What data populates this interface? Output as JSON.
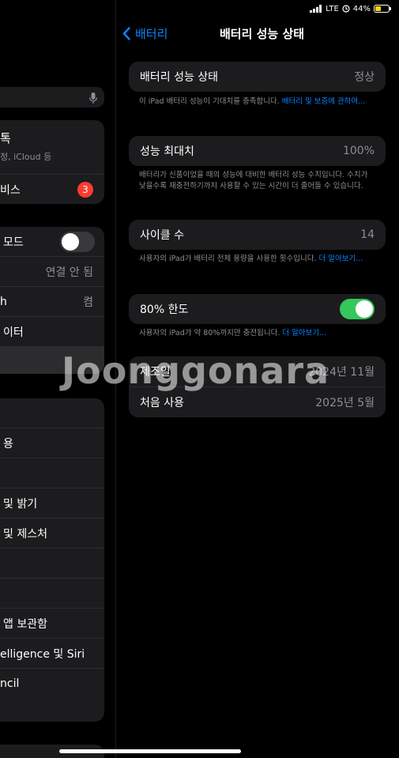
{
  "status_bar": {
    "carrier": "LTE",
    "battery_percent": "44%",
    "signal_bars": 4
  },
  "left_pane": {
    "profile": {
      "title": "톡",
      "subtitle": "정, iCloud 등"
    },
    "services_item": {
      "label": "비스",
      "badge": "3"
    },
    "airplane_mode": {
      "label": "모드",
      "on": false
    },
    "wifi": {
      "label": "",
      "value": "연결 안 됨"
    },
    "bluetooth": {
      "label": "h",
      "value": "켬"
    },
    "cellular": {
      "label": "이터"
    },
    "items": [
      {
        "label": ""
      },
      {
        "label": "용"
      },
      {
        "label": ""
      },
      {
        "label": "및 밝기"
      },
      {
        "label": "및 제스처"
      },
      {
        "label": ""
      },
      {
        "label": ""
      },
      {
        "label": "앱 보관함"
      },
      {
        "label": "elligence 및 Siri"
      },
      {
        "label": "ncil"
      }
    ]
  },
  "nav": {
    "back_label": "배터리",
    "title": "배터리 성능 상태"
  },
  "health": {
    "label": "배터리 성능 상태",
    "value": "정상",
    "note": "이 iPad 배터리 성능이 기대치를 충족합니다.",
    "note_link": "배터리 및 보증에 관하여..."
  },
  "max_capacity": {
    "label": "성능 최대치",
    "value": "100%",
    "note": "배터리가 신품이었을 때의 성능에 대비한 배터리 성능 수치입니다. 수치가 낮을수록 재충전하기까지 사용할 수 있는 시간이 더 줄어들 수 있습니다."
  },
  "cycle_count": {
    "label": "사이클 수",
    "value": "14",
    "note": "사용자의 iPad가 배터리 전체 용량을 사용한 횟수입니다.",
    "note_link": "더 알아보기..."
  },
  "limit_80": {
    "label": "80% 한도",
    "on": true,
    "note": "사용자의 iPad가 약 80%까지만 충전됩니다.",
    "note_link": "더 알아보기..."
  },
  "dates": {
    "manufactured_label": "제조일",
    "manufactured_value": "2024년 11월",
    "first_use_label": "처음 사용",
    "first_use_value": "2025년 5월"
  },
  "watermark": "Joonggonara",
  "colors": {
    "accent": "#0a84ff",
    "toggle_on": "#34c759",
    "badge": "#ff3b30",
    "battery_fill": "#ffd60a"
  }
}
